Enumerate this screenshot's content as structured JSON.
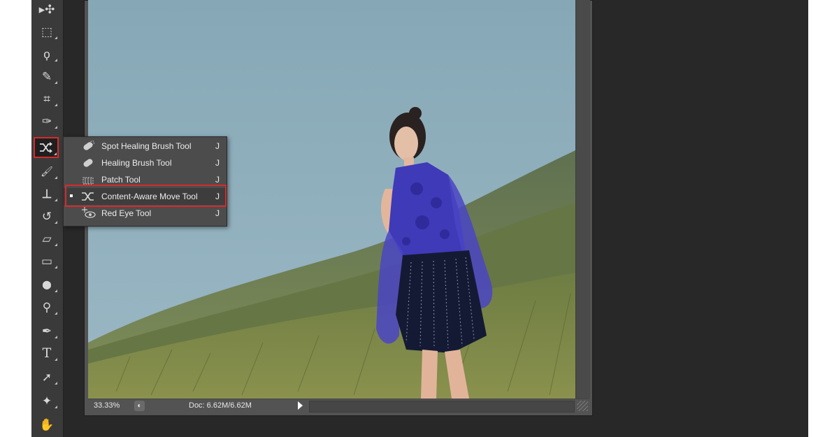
{
  "toolbar": {
    "tools": [
      {
        "name": "move-tool",
        "icon": "move-icon",
        "glyph": "▸✣"
      },
      {
        "name": "marquee-tool",
        "icon": "rectangular-marquee-icon",
        "glyph": "⬚"
      },
      {
        "name": "lasso-tool",
        "icon": "lasso-icon",
        "glyph": "ϙ"
      },
      {
        "name": "quick-selection-tool",
        "icon": "quick-selection-icon",
        "glyph": "✎"
      },
      {
        "name": "crop-tool",
        "icon": "crop-icon",
        "glyph": "⌗"
      },
      {
        "name": "eyedropper-tool",
        "icon": "eyedropper-icon",
        "glyph": "✑"
      },
      {
        "name": "content-aware-move-tool",
        "icon": "content-aware-move-icon",
        "glyph": "⤨"
      },
      {
        "name": "brush-tool",
        "icon": "brush-icon",
        "glyph": "🖌"
      },
      {
        "name": "clone-stamp-tool",
        "icon": "stamp-icon",
        "glyph": "⊥"
      },
      {
        "name": "history-brush-tool",
        "icon": "history-brush-icon",
        "glyph": "↺"
      },
      {
        "name": "eraser-tool",
        "icon": "eraser-icon",
        "glyph": "▱"
      },
      {
        "name": "gradient-tool",
        "icon": "gradient-icon",
        "glyph": "▭"
      },
      {
        "name": "blur-tool",
        "icon": "blur-drop-icon",
        "glyph": "⬤"
      },
      {
        "name": "dodge-tool",
        "icon": "dodge-icon",
        "glyph": "⚲"
      },
      {
        "name": "pen-tool",
        "icon": "pen-icon",
        "glyph": "✒"
      },
      {
        "name": "type-tool",
        "icon": "type-icon",
        "glyph": "T"
      },
      {
        "name": "path-selection-tool",
        "icon": "path-selection-icon",
        "glyph": "➚"
      },
      {
        "name": "custom-shape-tool",
        "icon": "custom-shape-icon",
        "glyph": "✦"
      },
      {
        "name": "hand-tool",
        "icon": "hand-icon",
        "glyph": "✋"
      }
    ]
  },
  "flyout": {
    "items": [
      {
        "label": "Spot Healing Brush Tool",
        "shortcut": "J",
        "icon": "spot-healing-brush-icon",
        "active": false
      },
      {
        "label": "Healing Brush Tool",
        "shortcut": "J",
        "icon": "healing-brush-icon",
        "active": false
      },
      {
        "label": "Patch Tool",
        "shortcut": "J",
        "icon": "patch-icon",
        "active": false
      },
      {
        "label": "Content-Aware Move Tool",
        "shortcut": "J",
        "icon": "content-aware-move-icon",
        "active": true
      },
      {
        "label": "Red Eye Tool",
        "shortcut": "J",
        "icon": "red-eye-icon",
        "active": false
      }
    ]
  },
  "status_bar": {
    "zoom": "33.33%",
    "doc_info": "Doc: 6.62M/6.62M"
  },
  "colors": {
    "highlight": "#d42b2b",
    "workspace": "#282828",
    "toolbar": "#3a3a3a",
    "dress": "#3f3ab8"
  }
}
